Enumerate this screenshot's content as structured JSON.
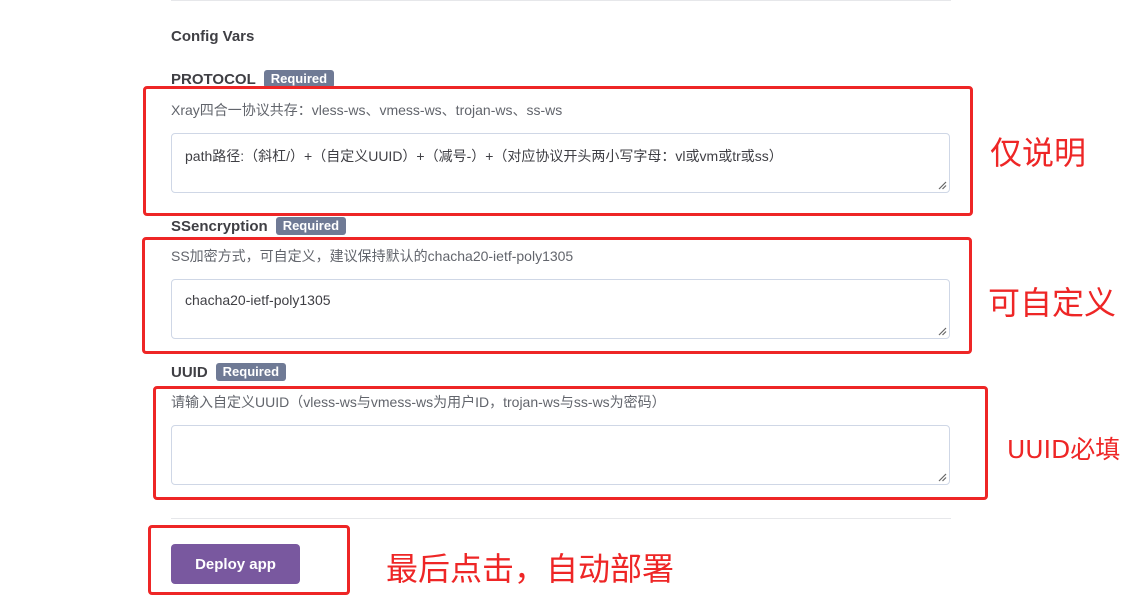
{
  "section": {
    "title": "Config Vars"
  },
  "badge_label": "Required",
  "fields": [
    {
      "label": "PROTOCOL",
      "description": "Xray四合一协议共存：vless-ws、vmess-ws、trojan-ws、ss-ws",
      "value": "path路径:（斜杠/）+（自定义UUID）+（减号-）+（对应协议开头两小写字母：vl或vm或tr或ss）"
    },
    {
      "label": "SSencryption",
      "description": "SS加密方式，可自定义，建议保持默认的chacha20-ietf-poly1305",
      "value": "chacha20-ietf-poly1305"
    },
    {
      "label": "UUID",
      "description": "请输入自定义UUID（vless-ws与vmess-ws为用户ID，trojan-ws与ss-ws为密码）",
      "value": ""
    }
  ],
  "deploy": {
    "label": "Deploy app"
  },
  "annotations": {
    "protocol_note": "仅说明",
    "ssencryption_note": "可自定义",
    "uuid_note": "UUID必填",
    "deploy_note": "最后点击，自动部署"
  },
  "colors": {
    "accent": "#79589f",
    "badge": "#6f7a95",
    "annotation": "#ee2626"
  }
}
